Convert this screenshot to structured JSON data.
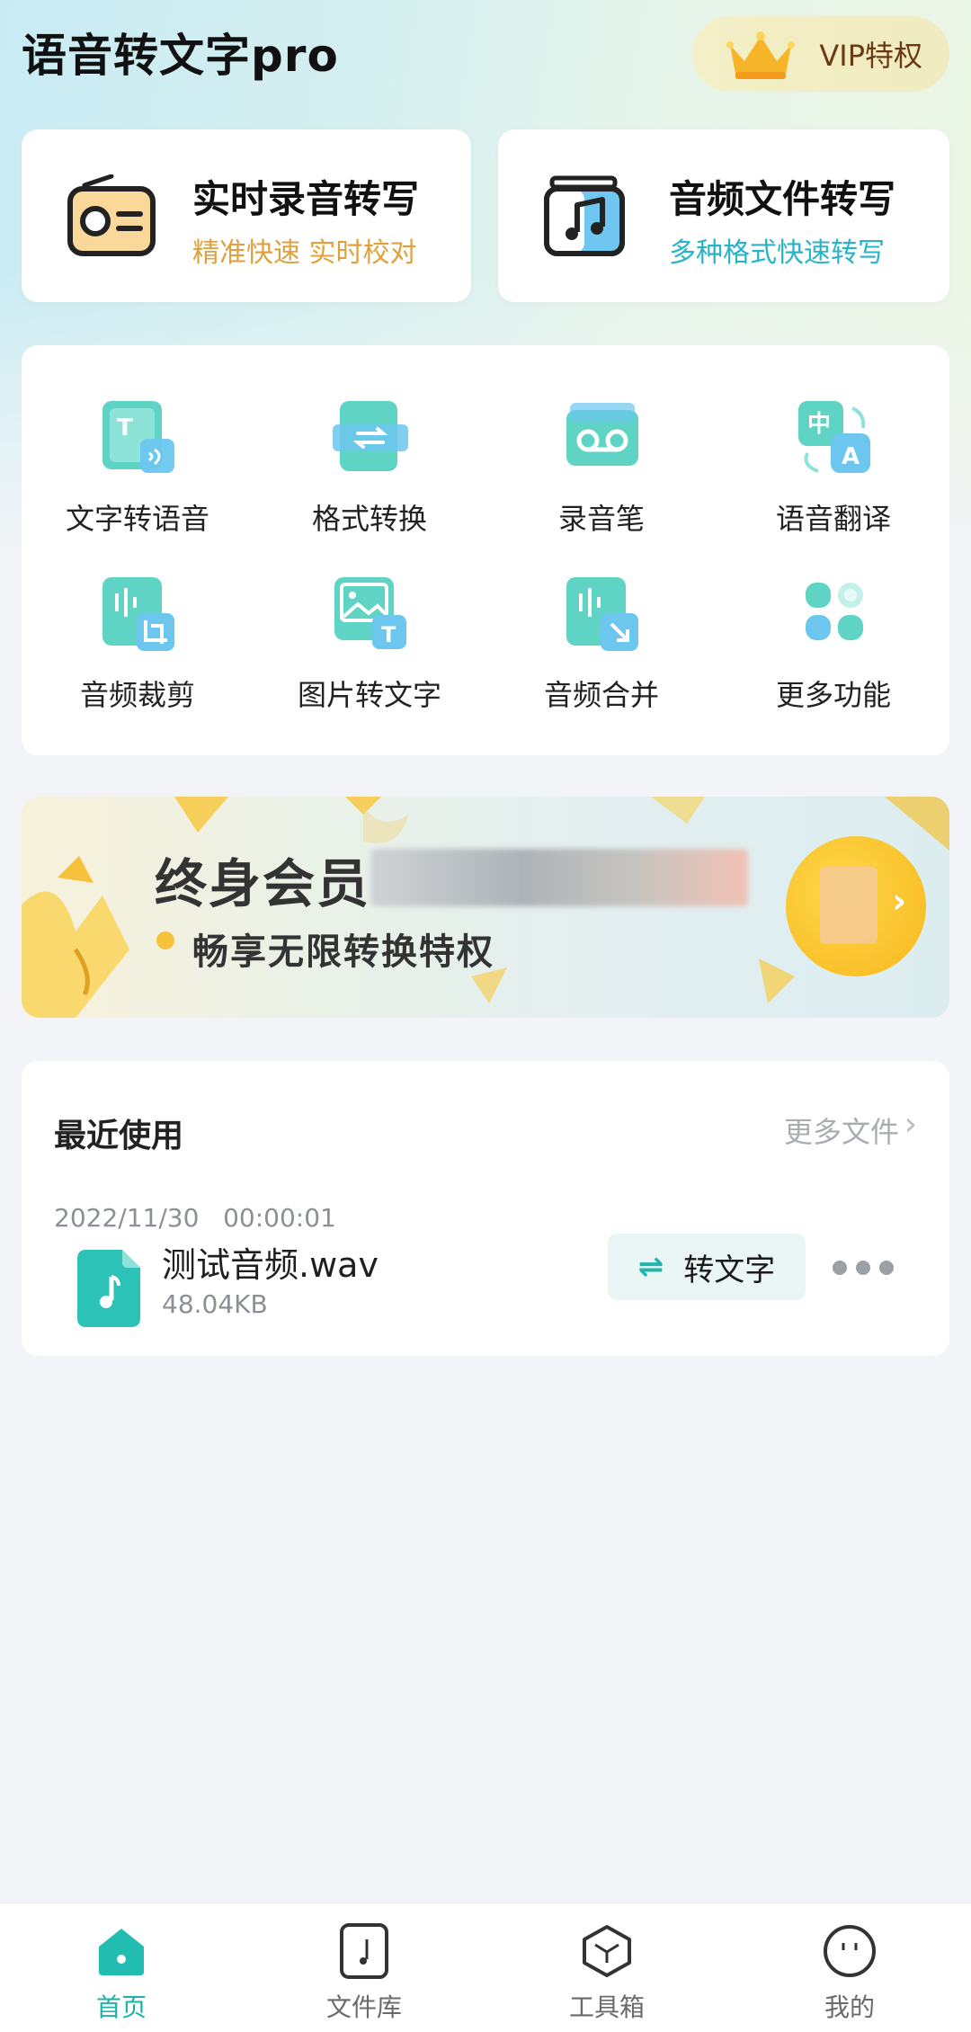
{
  "app": {
    "title": "语音转文字pro"
  },
  "vip": {
    "label": "VIP特权",
    "icon": "crown-icon"
  },
  "features": [
    {
      "title": "实时录音转写",
      "subtitle": "精准快速 实时校对",
      "icon": "radio-icon",
      "subtitle_color": "#e0a03c"
    },
    {
      "title": "音频文件转写",
      "subtitle": "多种格式快速转写",
      "icon": "music-file-icon",
      "subtitle_color": "#28b4c8"
    }
  ],
  "tools": [
    {
      "label": "文字转语音",
      "icon": "text-to-speech-icon"
    },
    {
      "label": "格式转换",
      "icon": "format-convert-icon"
    },
    {
      "label": "录音笔",
      "icon": "recorder-icon"
    },
    {
      "label": "语音翻译",
      "icon": "translate-icon"
    },
    {
      "label": "音频裁剪",
      "icon": "audio-crop-icon"
    },
    {
      "label": "图片转文字",
      "icon": "image-to-text-icon"
    },
    {
      "label": "音频合并",
      "icon": "audio-merge-icon"
    },
    {
      "label": "更多功能",
      "icon": "more-apps-icon"
    }
  ],
  "banner": {
    "title": "终身会员",
    "subtitle": "畅享无限转换特权"
  },
  "recent": {
    "title": "最近使用",
    "more_label": "更多文件",
    "items": [
      {
        "date": "2022/11/30",
        "duration": "00:00:01",
        "name": "测试音频.wav",
        "size": "48.04KB",
        "action_label": "转文字"
      }
    ]
  },
  "tabbar": {
    "items": [
      {
        "label": "首页",
        "icon": "home-icon",
        "active": true
      },
      {
        "label": "文件库",
        "icon": "file-library-icon",
        "active": false
      },
      {
        "label": "工具箱",
        "icon": "toolbox-icon",
        "active": false
      },
      {
        "label": "我的",
        "icon": "profile-icon",
        "active": false
      }
    ]
  },
  "colors": {
    "accent": "#1bb3a8",
    "teal_icon": "#5fd3c4",
    "background": "#f3f4f7"
  }
}
